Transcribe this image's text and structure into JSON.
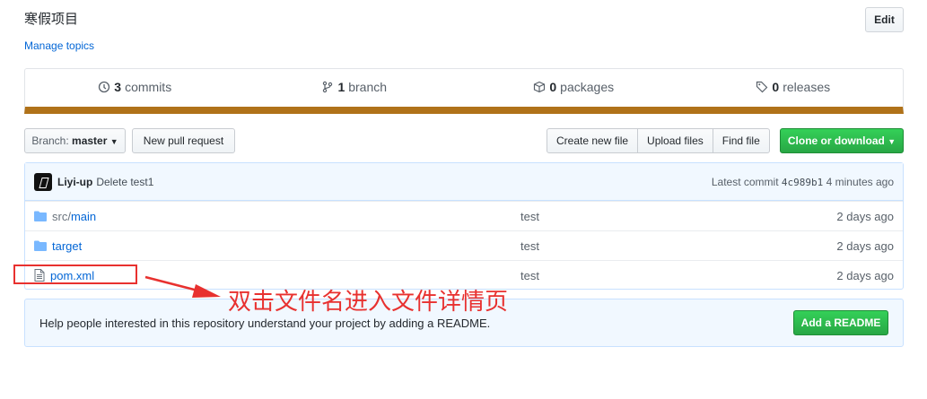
{
  "repo": {
    "description": "寒假项目",
    "manage_topics": "Manage topics",
    "edit_label": "Edit"
  },
  "stats": {
    "commits_count": "3",
    "commits_label": "commits",
    "branch_count": "1",
    "branch_label": "branch",
    "packages_count": "0",
    "packages_label": "packages",
    "releases_count": "0",
    "releases_label": "releases",
    "language_bar_color": "#b07219"
  },
  "toolbar": {
    "branch_prefix": "Branch:",
    "branch_name": "master",
    "new_pull_request": "New pull request",
    "create_new_file": "Create new file",
    "upload_files": "Upload files",
    "find_file": "Find file",
    "clone_or_download": "Clone or download",
    "accent": "#28a745"
  },
  "commit": {
    "author": "Liyi-up",
    "message": "Delete test1",
    "latest_label": "Latest commit",
    "sha": "4c989b1",
    "age": "4 minutes ago"
  },
  "files": [
    {
      "icon": "folder-icon",
      "prefix": "src/",
      "name": "main",
      "message": "test",
      "age": "2 days ago"
    },
    {
      "icon": "folder-icon",
      "prefix": "",
      "name": "target",
      "message": "test",
      "age": "2 days ago"
    },
    {
      "icon": "file-icon",
      "prefix": "",
      "name": "pom.xml",
      "message": "test",
      "age": "2 days ago"
    }
  ],
  "readme": {
    "text": "Help people interested in this repository understand your project by adding a README.",
    "button": "Add a README"
  },
  "annotation": {
    "text": "双击文件名进入文件详情页",
    "color": "#e8312f"
  }
}
